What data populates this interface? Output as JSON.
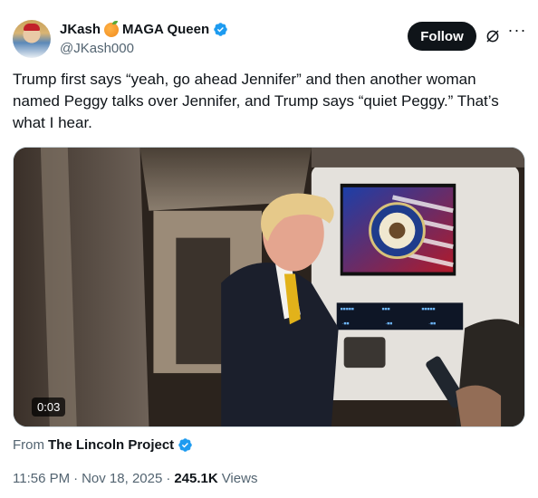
{
  "author": {
    "display_name": "JKash",
    "display_name_suffix": "MAGA Queen",
    "handle": "@JKash000",
    "avatar_icon": "profile-photo-avatar",
    "verified_color": "#1d9bf0"
  },
  "actions": {
    "follow_label": "Follow",
    "grok_icon": "grok-icon",
    "more_icon": "more-horizontal-icon"
  },
  "tweet": {
    "text": "Trump first says “yeah, go ahead Jennifer” and then another woman named Peggy talks over Jennifer, and Trump says “quiet Peggy.”  That’s what I hear."
  },
  "media": {
    "type": "video",
    "duration": "0:03"
  },
  "source": {
    "prefix": "From",
    "name": "The Lincoln Project"
  },
  "meta": {
    "time": "11:56 PM",
    "separator": "·",
    "date": "Nov 18, 2025",
    "views_count": "245.1K",
    "views_label": "Views"
  },
  "colors": {
    "text_primary": "#0f1419",
    "text_secondary": "#536471",
    "accent": "#1d9bf0"
  }
}
